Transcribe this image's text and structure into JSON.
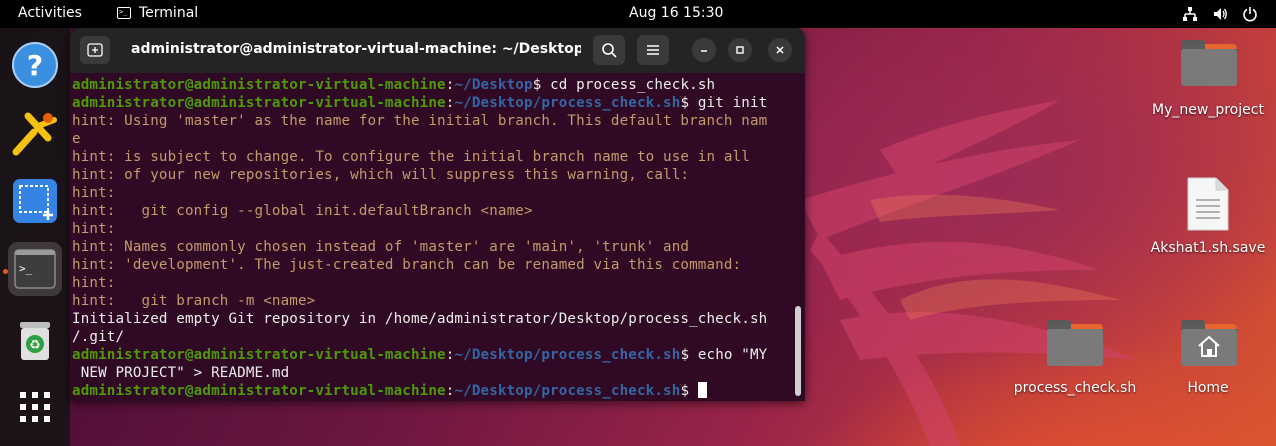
{
  "topbar": {
    "activities": "Activities",
    "app_name": "Terminal",
    "app_icon_text": ">_",
    "clock": "Aug 16  15:30",
    "tray_icons": [
      "network-icon",
      "volume-icon",
      "power-icon"
    ]
  },
  "dock": {
    "items": [
      {
        "name": "help-icon",
        "label": "Help"
      },
      {
        "name": "app-icon-yellow",
        "label": "Application"
      },
      {
        "name": "screenshot-icon",
        "label": "Screenshot"
      },
      {
        "name": "terminal-icon",
        "label": "Terminal",
        "running": true
      },
      {
        "name": "trash-icon",
        "label": "Trash"
      },
      {
        "name": "show-apps-icon",
        "label": "Show Applications"
      }
    ],
    "terminal_glyph": ">_"
  },
  "terminal": {
    "title": "administrator@administrator-virtual-machine: ~/Desktop/pr...",
    "lines": [
      {
        "type": "prompt",
        "user": "administrator@administrator-virtual-machine",
        "path": "~/Desktop",
        "cmd": "$ cd process_check.sh"
      },
      {
        "type": "prompt",
        "user": "administrator@administrator-virtual-machine",
        "path": "~/Desktop/process_check.sh",
        "cmd": "$ git init"
      },
      {
        "type": "hint",
        "text": "hint: Using 'master' as the name for the initial branch. This default branch nam"
      },
      {
        "type": "hint",
        "text": "e"
      },
      {
        "type": "hint",
        "text": "hint: is subject to change. To configure the initial branch name to use in all"
      },
      {
        "type": "hint",
        "text": "hint: of your new repositories, which will suppress this warning, call:"
      },
      {
        "type": "hint",
        "text": "hint:"
      },
      {
        "type": "hint",
        "text": "hint:   git config --global init.defaultBranch <name>"
      },
      {
        "type": "hint",
        "text": "hint:"
      },
      {
        "type": "hint",
        "text": "hint: Names commonly chosen instead of 'master' are 'main', 'trunk' and"
      },
      {
        "type": "hint",
        "text": "hint: 'development'. The just-created branch can be renamed via this command:"
      },
      {
        "type": "hint",
        "text": "hint:"
      },
      {
        "type": "hint",
        "text": "hint:   git branch -m <name>"
      },
      {
        "type": "out",
        "text": "Initialized empty Git repository in /home/administrator/Desktop/process_check.sh"
      },
      {
        "type": "out",
        "text": "/.git/"
      },
      {
        "type": "prompt",
        "user": "administrator@administrator-virtual-machine",
        "path": "~/Desktop/process_check.sh",
        "cmd": "$ echo \"MY"
      },
      {
        "type": "out",
        "text": " NEW PROJECT\" > README.md"
      },
      {
        "type": "prompt",
        "user": "administrator@administrator-virtual-machine",
        "path": "~/Desktop/process_check.sh",
        "cmd": "$ ",
        "cursor": true
      }
    ]
  },
  "desktop": {
    "icons": [
      {
        "name": "folder-my-new-project",
        "label": "My_new_project",
        "kind": "folder"
      },
      {
        "name": "file-akshat1",
        "label": "Akshat1.sh.save",
        "kind": "file"
      },
      {
        "name": "folder-process-check",
        "label": "process_check.sh",
        "kind": "folder"
      },
      {
        "name": "folder-home",
        "label": "Home",
        "kind": "home"
      }
    ]
  },
  "colors": {
    "terminal_bg": "#300a24",
    "prompt_user": "#4e9a06",
    "prompt_path": "#3465a4",
    "hint_text": "#c39a6b",
    "ubuntu_orange": "#e95420"
  }
}
